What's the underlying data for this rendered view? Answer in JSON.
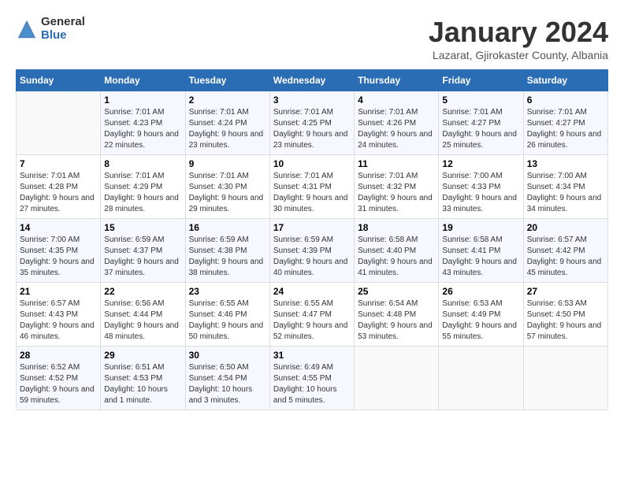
{
  "header": {
    "logo_general": "General",
    "logo_blue": "Blue",
    "title": "January 2024",
    "subtitle": "Lazarat, Gjirokaster County, Albania"
  },
  "calendar": {
    "days_of_week": [
      "Sunday",
      "Monday",
      "Tuesday",
      "Wednesday",
      "Thursday",
      "Friday",
      "Saturday"
    ],
    "weeks": [
      [
        {
          "day": "",
          "sunrise": "",
          "sunset": "",
          "daylight": ""
        },
        {
          "day": "1",
          "sunrise": "Sunrise: 7:01 AM",
          "sunset": "Sunset: 4:23 PM",
          "daylight": "Daylight: 9 hours and 22 minutes."
        },
        {
          "day": "2",
          "sunrise": "Sunrise: 7:01 AM",
          "sunset": "Sunset: 4:24 PM",
          "daylight": "Daylight: 9 hours and 23 minutes."
        },
        {
          "day": "3",
          "sunrise": "Sunrise: 7:01 AM",
          "sunset": "Sunset: 4:25 PM",
          "daylight": "Daylight: 9 hours and 23 minutes."
        },
        {
          "day": "4",
          "sunrise": "Sunrise: 7:01 AM",
          "sunset": "Sunset: 4:26 PM",
          "daylight": "Daylight: 9 hours and 24 minutes."
        },
        {
          "day": "5",
          "sunrise": "Sunrise: 7:01 AM",
          "sunset": "Sunset: 4:27 PM",
          "daylight": "Daylight: 9 hours and 25 minutes."
        },
        {
          "day": "6",
          "sunrise": "Sunrise: 7:01 AM",
          "sunset": "Sunset: 4:27 PM",
          "daylight": "Daylight: 9 hours and 26 minutes."
        }
      ],
      [
        {
          "day": "7",
          "sunrise": "Sunrise: 7:01 AM",
          "sunset": "Sunset: 4:28 PM",
          "daylight": "Daylight: 9 hours and 27 minutes."
        },
        {
          "day": "8",
          "sunrise": "Sunrise: 7:01 AM",
          "sunset": "Sunset: 4:29 PM",
          "daylight": "Daylight: 9 hours and 28 minutes."
        },
        {
          "day": "9",
          "sunrise": "Sunrise: 7:01 AM",
          "sunset": "Sunset: 4:30 PM",
          "daylight": "Daylight: 9 hours and 29 minutes."
        },
        {
          "day": "10",
          "sunrise": "Sunrise: 7:01 AM",
          "sunset": "Sunset: 4:31 PM",
          "daylight": "Daylight: 9 hours and 30 minutes."
        },
        {
          "day": "11",
          "sunrise": "Sunrise: 7:01 AM",
          "sunset": "Sunset: 4:32 PM",
          "daylight": "Daylight: 9 hours and 31 minutes."
        },
        {
          "day": "12",
          "sunrise": "Sunrise: 7:00 AM",
          "sunset": "Sunset: 4:33 PM",
          "daylight": "Daylight: 9 hours and 33 minutes."
        },
        {
          "day": "13",
          "sunrise": "Sunrise: 7:00 AM",
          "sunset": "Sunset: 4:34 PM",
          "daylight": "Daylight: 9 hours and 34 minutes."
        }
      ],
      [
        {
          "day": "14",
          "sunrise": "Sunrise: 7:00 AM",
          "sunset": "Sunset: 4:35 PM",
          "daylight": "Daylight: 9 hours and 35 minutes."
        },
        {
          "day": "15",
          "sunrise": "Sunrise: 6:59 AM",
          "sunset": "Sunset: 4:37 PM",
          "daylight": "Daylight: 9 hours and 37 minutes."
        },
        {
          "day": "16",
          "sunrise": "Sunrise: 6:59 AM",
          "sunset": "Sunset: 4:38 PM",
          "daylight": "Daylight: 9 hours and 38 minutes."
        },
        {
          "day": "17",
          "sunrise": "Sunrise: 6:59 AM",
          "sunset": "Sunset: 4:39 PM",
          "daylight": "Daylight: 9 hours and 40 minutes."
        },
        {
          "day": "18",
          "sunrise": "Sunrise: 6:58 AM",
          "sunset": "Sunset: 4:40 PM",
          "daylight": "Daylight: 9 hours and 41 minutes."
        },
        {
          "day": "19",
          "sunrise": "Sunrise: 6:58 AM",
          "sunset": "Sunset: 4:41 PM",
          "daylight": "Daylight: 9 hours and 43 minutes."
        },
        {
          "day": "20",
          "sunrise": "Sunrise: 6:57 AM",
          "sunset": "Sunset: 4:42 PM",
          "daylight": "Daylight: 9 hours and 45 minutes."
        }
      ],
      [
        {
          "day": "21",
          "sunrise": "Sunrise: 6:57 AM",
          "sunset": "Sunset: 4:43 PM",
          "daylight": "Daylight: 9 hours and 46 minutes."
        },
        {
          "day": "22",
          "sunrise": "Sunrise: 6:56 AM",
          "sunset": "Sunset: 4:44 PM",
          "daylight": "Daylight: 9 hours and 48 minutes."
        },
        {
          "day": "23",
          "sunrise": "Sunrise: 6:55 AM",
          "sunset": "Sunset: 4:46 PM",
          "daylight": "Daylight: 9 hours and 50 minutes."
        },
        {
          "day": "24",
          "sunrise": "Sunrise: 6:55 AM",
          "sunset": "Sunset: 4:47 PM",
          "daylight": "Daylight: 9 hours and 52 minutes."
        },
        {
          "day": "25",
          "sunrise": "Sunrise: 6:54 AM",
          "sunset": "Sunset: 4:48 PM",
          "daylight": "Daylight: 9 hours and 53 minutes."
        },
        {
          "day": "26",
          "sunrise": "Sunrise: 6:53 AM",
          "sunset": "Sunset: 4:49 PM",
          "daylight": "Daylight: 9 hours and 55 minutes."
        },
        {
          "day": "27",
          "sunrise": "Sunrise: 6:53 AM",
          "sunset": "Sunset: 4:50 PM",
          "daylight": "Daylight: 9 hours and 57 minutes."
        }
      ],
      [
        {
          "day": "28",
          "sunrise": "Sunrise: 6:52 AM",
          "sunset": "Sunset: 4:52 PM",
          "daylight": "Daylight: 9 hours and 59 minutes."
        },
        {
          "day": "29",
          "sunrise": "Sunrise: 6:51 AM",
          "sunset": "Sunset: 4:53 PM",
          "daylight": "Daylight: 10 hours and 1 minute."
        },
        {
          "day": "30",
          "sunrise": "Sunrise: 6:50 AM",
          "sunset": "Sunset: 4:54 PM",
          "daylight": "Daylight: 10 hours and 3 minutes."
        },
        {
          "day": "31",
          "sunrise": "Sunrise: 6:49 AM",
          "sunset": "Sunset: 4:55 PM",
          "daylight": "Daylight: 10 hours and 5 minutes."
        },
        {
          "day": "",
          "sunrise": "",
          "sunset": "",
          "daylight": ""
        },
        {
          "day": "",
          "sunrise": "",
          "sunset": "",
          "daylight": ""
        },
        {
          "day": "",
          "sunrise": "",
          "sunset": "",
          "daylight": ""
        }
      ]
    ]
  }
}
